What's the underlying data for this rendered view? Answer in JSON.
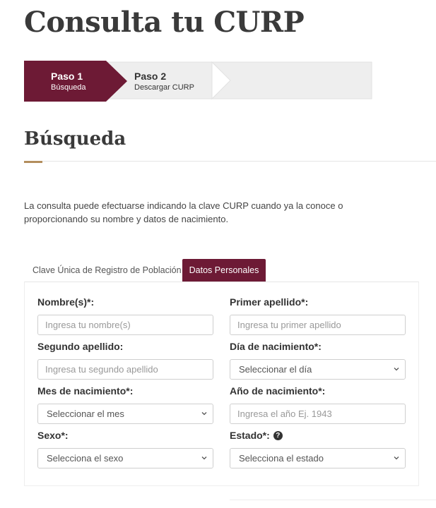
{
  "page": {
    "title": "Consulta tu CURP"
  },
  "stepper": {
    "steps": [
      {
        "title": "Paso 1",
        "subtitle": "Búsqueda",
        "active": true
      },
      {
        "title": "Paso 2",
        "subtitle": "Descargar CURP",
        "active": false
      }
    ],
    "active_color": "#6d1a35",
    "inactive_color": "#eeeeee"
  },
  "section": {
    "title": "Búsqueda",
    "accent_color": "#b38e5d",
    "intro": "La consulta puede efectuarse indicando la clave CURP cuando ya la conoce o proporcionando su nombre y datos de nacimiento."
  },
  "tabs": [
    {
      "label": "Clave Única de Registro de Población",
      "active": false
    },
    {
      "label": "Datos Personales",
      "active": true
    }
  ],
  "form": {
    "nombre": {
      "label": "Nombre(s)*:",
      "placeholder": "Ingresa tu nombre(s)"
    },
    "primer_apellido": {
      "label": "Primer apellido*:",
      "placeholder": "Ingresa tu primer apellido"
    },
    "segundo_apellido": {
      "label": "Segundo apellido:",
      "placeholder": "Ingresa tu segundo apellido"
    },
    "dia": {
      "label": "Día de nacimiento*:",
      "value": "Seleccionar el día"
    },
    "mes": {
      "label": "Mes de nacimiento*:",
      "value": "Seleccionar el mes"
    },
    "anio": {
      "label": "Año de nacimiento*:",
      "placeholder": "Ingresa el año Ej. 1943"
    },
    "sexo": {
      "label": "Sexo*:",
      "value": "Selecciona el sexo"
    },
    "estado": {
      "label": "Estado*:",
      "value": "Selecciona el estado",
      "help_icon": "question-circle-icon"
    }
  }
}
